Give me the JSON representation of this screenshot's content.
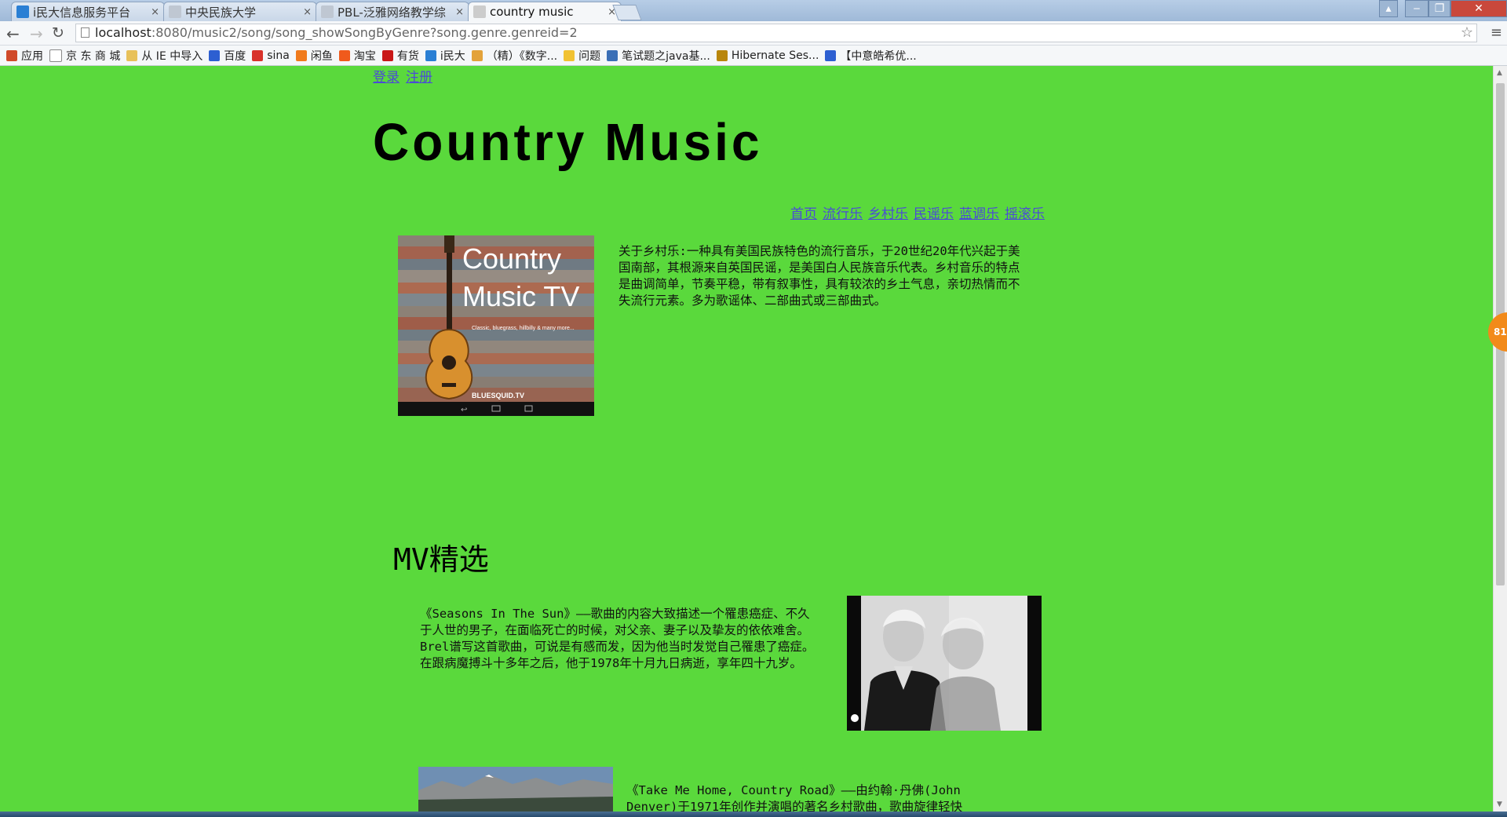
{
  "browser": {
    "tabs": [
      {
        "title": "i民大信息服务平台",
        "favicon_color": "#2a7fd4"
      },
      {
        "title": "中央民族大学",
        "favicon_color": "#bfc7d2"
      },
      {
        "title": "PBL-泛雅网络教学综",
        "favicon_color": "#bfc7d2"
      },
      {
        "title": "country music",
        "favicon_color": "#cccccc"
      }
    ],
    "close_glyph": "×",
    "url_host": "localhost",
    "url_rest": ":8080/music2/song/song_showSongByGenre?song.genre.genreid=2",
    "bookmarks": [
      {
        "label": "应用",
        "icon": "apps-icon",
        "color": "#d04a2a"
      },
      {
        "label": "京 东 商 城",
        "icon": "page-icon",
        "color": "#ffffff"
      },
      {
        "label": "从 IE 中导入",
        "icon": "folder-icon",
        "color": "#e8c15a"
      },
      {
        "label": "百度",
        "icon": "baidu-icon",
        "color": "#2d5fd1"
      },
      {
        "label": "sina",
        "icon": "weibo-icon",
        "color": "#d8322b"
      },
      {
        "label": "闲鱼",
        "icon": "xianyu-icon",
        "color": "#f07a1c"
      },
      {
        "label": "淘宝",
        "icon": "taobao-icon",
        "color": "#f05a1c"
      },
      {
        "label": "有货",
        "icon": "youhuo-icon",
        "color": "#c91818"
      },
      {
        "label": "i民大",
        "icon": "imd-icon",
        "color": "#2a7fd4"
      },
      {
        "label": "（精）《数字...",
        "icon": "doc-icon",
        "color": "#e3a23a"
      },
      {
        "label": "问题",
        "icon": "question-icon",
        "color": "#f1c232"
      },
      {
        "label": "笔试题之java基...",
        "icon": "gear-icon",
        "color": "#3b6fb6"
      },
      {
        "label": "Hibernate Ses...",
        "icon": "hibernate-icon",
        "color": "#b8860b"
      },
      {
        "label": "【中意皓希优...",
        "icon": "paw-icon",
        "color": "#2d5fd1"
      }
    ]
  },
  "page": {
    "auth": {
      "login": "登录",
      "register": "注册"
    },
    "title": "Country Music",
    "nav": [
      "首页",
      "流行乐",
      "乡村乐",
      "民谣乐",
      "蓝调乐",
      "摇滚乐"
    ],
    "hero_image": {
      "line1": "Country",
      "line2": "Music TV",
      "tagline": "Classic, bluegrass, hillbilly & many more...",
      "brand": "BLUESQUID.TV"
    },
    "intro": "关于乡村乐:一种具有美国民族特色的流行音乐，于20世纪20年代兴起于美国南部，其根源来自英国民谣，是美国白人民族音乐代表。乡村音乐的特点是曲调简单，节奏平稳，带有叙事性，具有较浓的乡土气息，亲切热情而不失流行元素。多为歌谣体、二部曲式或三部曲式。",
    "mv_heading": "MV精选",
    "mv1_text": "《Seasons In The Sun》——歌曲的内容大致描述一个罹患癌症、不久于人世的男子，在面临死亡的时候，对父亲、妻子以及挚友的依依难舍。Brel谱写这首歌曲，可说是有感而发，因为他当时发觉自己罹患了癌症。在跟病魔搏斗十多年之后，他于1978年十月九日病逝，享年四十九岁。",
    "mv2_text": "《Take Me Home, Country Road》——由约翰·丹佛(John Denver)于1971年创作并演唱的著名乡村歌曲，歌曲旋律轻快"
  },
  "floating_badge": "81",
  "colors": {
    "page_bg": "#5ad93c",
    "link": "#4b4bd6"
  }
}
